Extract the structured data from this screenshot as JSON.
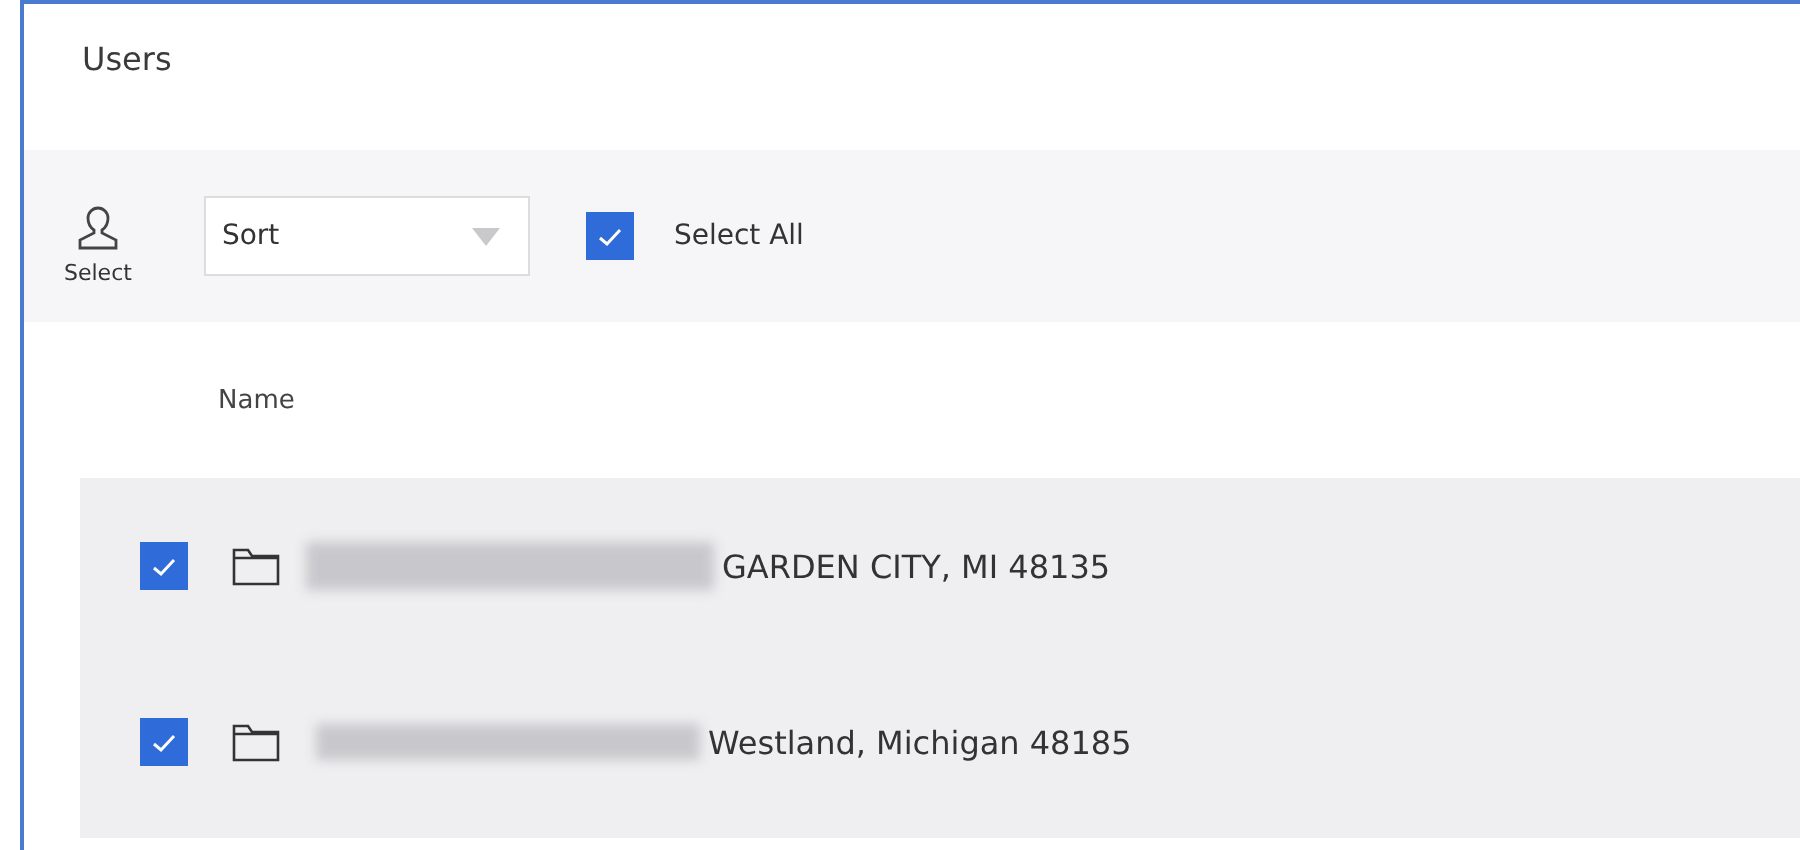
{
  "panel": {
    "title": "Users"
  },
  "toolbar": {
    "select_label": "Select",
    "sort": {
      "label": "Sort"
    },
    "select_all": {
      "label": "Select All",
      "checked": true
    }
  },
  "table": {
    "columns": [
      "Name"
    ],
    "rows": [
      {
        "checked": true,
        "redacted": true,
        "name": "GARDEN CITY, MI 48135"
      },
      {
        "checked": true,
        "redacted": true,
        "name": "Westland, Michigan 48185"
      }
    ]
  }
}
